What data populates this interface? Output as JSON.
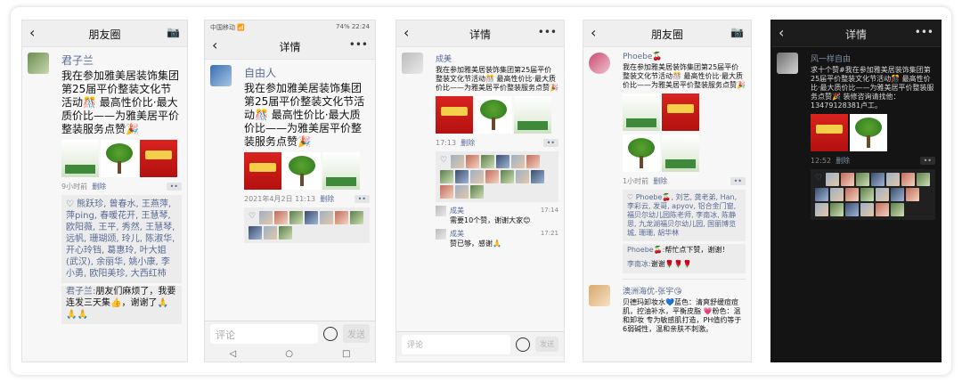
{
  "panel1": {
    "header": {
      "back": "‹",
      "title": "朋友圈",
      "camera": "📷"
    },
    "post": {
      "author": "君子兰",
      "text": "我在参加雅美居装饰集团第25届平价整装文化节活动🎊 最高性价比·最大质价比——为雅美居平价整装服务点赞🎉",
      "time": "9小时前",
      "delete": "删除",
      "more": "••"
    },
    "likes": "♡ 熊跃珍, 曾春水, 王燕萍, 萍ping, 春暖花开, 王慧琴, 欧阳薇, 王平, 秀然, 王慧琴, 远帆, 珊瑚颂, 玲儿, 陈淑华, 开心玲铛, 葛惠玲, 叶大姐(武汉), 余丽华, 姚小康, 李小勇, 欧阳美珍, 大西红柿",
    "comment": {
      "author": "君子兰:",
      "text": "朋友们麻烦了，我要连发三天集👍，谢谢了🙏🙏🙏"
    }
  },
  "panel2": {
    "status": {
      "left": "中国移动 📶",
      "right": "74% 22:24"
    },
    "header": {
      "back": "‹",
      "title": "详情",
      "more": "•••"
    },
    "post": {
      "author": "自由人",
      "text": "我在参加雅美居装饰集团第25届平价整装文化节活动🎊 最高性价比·最大质价比——为雅美居平价整装服务点赞🎉",
      "time": "2021年4月2日 11:13",
      "delete": "删除",
      "more": "••"
    },
    "input": {
      "placeholder": "评论",
      "send": "发送"
    },
    "nav": {
      "back": "◁",
      "home": "○",
      "recent": "□"
    }
  },
  "panel3": {
    "header": {
      "back": "‹",
      "title": "详情",
      "more": "•••"
    },
    "post": {
      "author": "成美",
      "text": "我在参加雅美居装饰集团第25届平价整装文化节活动🎊 最高性价比·最大质价比——为雅美居平价整装服务点赞🎉",
      "time": "17:13",
      "delete": "删除",
      "more": "••"
    },
    "comments": [
      {
        "author": "成美",
        "text": "需要10个赞，谢谢大家😊",
        "time": "17:14"
      },
      {
        "author": "成美",
        "text": "赞已够，感谢🙏",
        "time": "17:21"
      }
    ],
    "input": {
      "placeholder": "评论",
      "send": "发送"
    }
  },
  "panel4": {
    "header": {
      "back": "‹",
      "title": "朋友圈",
      "camera": "📷"
    },
    "post": {
      "author": "Phoebe🍒",
      "text": "我在参加雅美居装饰集团第25届平价整装文化节活动🎊 最高性价比·最大质价比——为雅美居平价整装服务点赞🎉",
      "time": "1小时前",
      "delete": "删除",
      "more": "••"
    },
    "likes": "♡ Phoebe🍒, 刘艺, 龚老弟, Han, 李彩云, 发哥, apyov, 铝合金门窗, 福贝尔幼儿园陈老师, 李南冰, 陈静思, 九龙湖福贝尔幼儿园, 国丽博览城, 珊珊, 胡华林",
    "comments": [
      {
        "author": "Phoebe🍒:",
        "text": "帮忙点下赞，谢谢！"
      },
      {
        "author": "李南冰:",
        "text": "谢谢🌹🌹🌹"
      }
    ],
    "post2": {
      "author": "澳洲海优-张宇😘",
      "text": "贝德玛卸妆水💙蓝色：清爽舒缓痘痘肌，控油补水，平衡皮脂 💗粉色：温和卸妆 专为敏感肌打造，PH值约等于6弱碱性，温和亲肤不刺激。"
    }
  },
  "panel5": {
    "header": {
      "back": "‹",
      "title": "详情",
      "more": "•••"
    },
    "post": {
      "author": "风一样自由",
      "text": "求十个赞#我在参加雅美居装饰集团第25届平价整装文化节活动🎊 最高性价比·最大质价比——为雅美居平价整装服务点赞🎉 装修咨询请找他：13479128381卢工。",
      "time": "12:52",
      "delete": "删除",
      "more": "••"
    }
  },
  "colors": {
    "link": "#576b95",
    "panel_bg": "#f7f7f7",
    "dark_bg": "#141414"
  }
}
